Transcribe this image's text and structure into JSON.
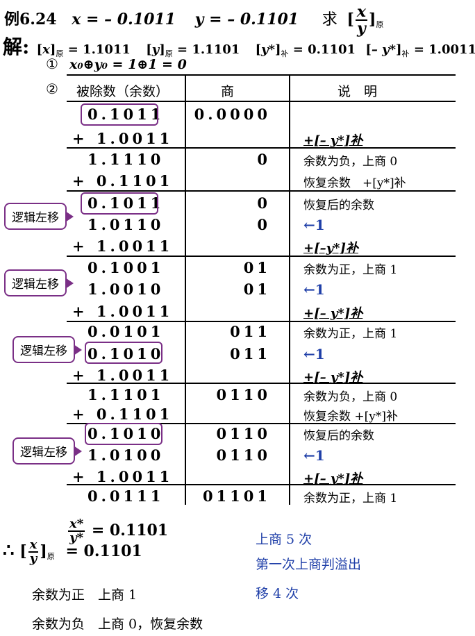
{
  "header": {
    "example_label": "例6.24",
    "x_def": "x = – 0.1011",
    "y_def": "y = – 0.1101",
    "ask": "求",
    "frac_num": "x",
    "frac_den": "y",
    "yuan": "原"
  },
  "solution": {
    "jie": "解:",
    "items": [
      {
        "var": "x",
        "sub": "原",
        "value": "= 1.1011"
      },
      {
        "var": "y",
        "sub": "原",
        "value": "= 1.1101"
      },
      {
        "var": "y*",
        "sub": "补",
        "value": "= 0.1101"
      },
      {
        "var": "– y*",
        "sub": "补",
        "value": "= 1.0011"
      }
    ]
  },
  "step1": {
    "marker": "①",
    "text": "x₀⊕y₀ = 1⊕1 = 0"
  },
  "step2": {
    "marker": "②"
  },
  "table": {
    "headers": [
      "被除数（余数）",
      "商",
      "说　明"
    ],
    "rows": [
      {
        "dividend": "0.1011",
        "quotient": "0.0000",
        "note": ""
      },
      {
        "dividend": "+ 1.0011",
        "quotient": "",
        "note": "+[– y*]补"
      },
      {
        "dividend": "1.1110",
        "quotient": "0",
        "note": "余数为负，上商 0"
      },
      {
        "dividend": "+ 0.1101",
        "quotient": "",
        "note": "恢复余数　+[y*]补"
      },
      {
        "dividend": "0.1011",
        "quotient": "0",
        "note": "恢复后的余数"
      },
      {
        "dividend": "1.0110",
        "quotient": "0",
        "note": "←1"
      },
      {
        "dividend": "+ 1.0011",
        "quotient": "",
        "note": "+[–y*]补"
      },
      {
        "dividend": "0.1001",
        "quotient": "01",
        "note": "余数为正，上商 1"
      },
      {
        "dividend": "1.0010",
        "quotient": "01",
        "note": "←1"
      },
      {
        "dividend": "+ 1.0011",
        "quotient": "",
        "note": "+[– y*]补"
      },
      {
        "dividend": "0.0101",
        "quotient": "011",
        "note": "余数为正，上商 1"
      },
      {
        "dividend": "0.1010",
        "quotient": "011",
        "note": "←1"
      },
      {
        "dividend": "+ 1.0011",
        "quotient": "",
        "note": "+[– y*]补"
      },
      {
        "dividend": "1.1101",
        "quotient": "0110",
        "note": "余数为负，上商 0"
      },
      {
        "dividend": "+ 0.1101",
        "quotient": "",
        "note": "恢复余数 +[y*]补"
      },
      {
        "dividend": "0.1010",
        "quotient": "0110",
        "note": "恢复后的余数"
      },
      {
        "dividend": "1.0100",
        "quotient": "0110",
        "note": "←1"
      },
      {
        "dividend": "+ 1.0011",
        "quotient": "",
        "note": "+[– y*]补"
      },
      {
        "dividend": "0.0111",
        "quotient": "01101",
        "note": "余数为正，上商 1"
      }
    ]
  },
  "callouts": [
    "逻辑左移",
    "逻辑左移",
    "逻辑左移",
    "逻辑左移"
  ],
  "result": {
    "frac_num": "x*",
    "frac_den": "y*",
    "value1": "= 0.1101",
    "therefore": "∴",
    "value2": "= 0.1101",
    "yuan": "原"
  },
  "summary": {
    "shang_count": "上商 5 次",
    "overflow": "第一次上商判溢出",
    "shift_count": "移 4 次"
  },
  "rules": {
    "positive": "余数为正　上商 1",
    "negative": "余数为负　上商 0，恢复余数"
  },
  "colors": {
    "accent_blue": "#1f3fa8",
    "box_purple": "#7a2f86"
  }
}
